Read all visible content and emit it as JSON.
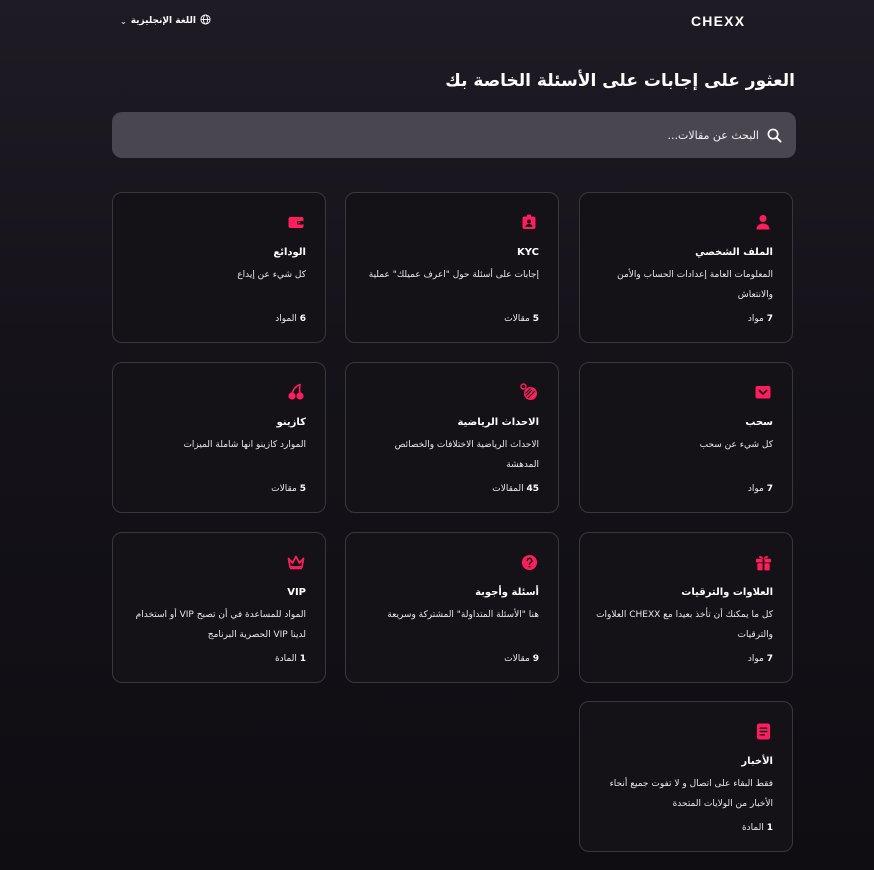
{
  "brand": {
    "logo_text": "CHEXX",
    "accent": "#ff1d5e"
  },
  "header": {
    "language_label": "اللغة الإنجليزية"
  },
  "hero": {
    "title": "العثور على إجابات على الأسئلة الخاصة بك"
  },
  "search": {
    "placeholder": "البحث عن مقالات..."
  },
  "cards": [
    {
      "icon": "user-icon",
      "title": "الملف الشخصي",
      "desc": "المعلومات العامة إعدادات الحساب والأمن والانتعاش",
      "count_num": "7",
      "count_unit": "مواد"
    },
    {
      "icon": "id-badge-icon",
      "title": "KYC",
      "desc": "إجابات على أسئلة حول \"اعرف عميلك\" عملية",
      "count_num": "5",
      "count_unit": "مقالات"
    },
    {
      "icon": "wallet-icon",
      "title": "الودائع",
      "desc": "كل شيء عن إيداع",
      "count_num": "6",
      "count_unit": "المواد"
    },
    {
      "icon": "withdraw-icon",
      "title": "سحب",
      "desc": "كل شيء عن سحب",
      "count_num": "7",
      "count_unit": "مواد"
    },
    {
      "icon": "sports-ball-icon",
      "title": "الاحداث الرياضية",
      "desc": "الاحداث الرياضية الاختلافات والخصائص المدهشة",
      "count_num": "45",
      "count_unit": "المقالات"
    },
    {
      "icon": "cherries-icon",
      "title": "كازينو",
      "desc": "الموارد كازينو انها شاملة الميزات",
      "count_num": "5",
      "count_unit": "مقالات"
    },
    {
      "icon": "gift-icon",
      "title": "العلاوات والترقيات",
      "desc": "كل ما يمكنك أن تأخذ بعيدا مع CHEXX العلاوات والترقيات",
      "count_num": "7",
      "count_unit": "مواد"
    },
    {
      "icon": "question-icon",
      "title": "أسئلة وأجوبة",
      "desc": "هنا \"الأسئلة المتداولة\" المشتركة وسريعة",
      "count_num": "9",
      "count_unit": "مقالات"
    },
    {
      "icon": "crown-icon",
      "title": "VIP",
      "desc": "المواد للمساعدة في أن تصبح VIP أو استخدام لدينا VIP الحصرية البرنامج",
      "count_num": "1",
      "count_unit": "المادة"
    },
    {
      "icon": "news-icon",
      "title": "الأخبار",
      "desc": "فقط البقاء على اتصال و لا تفوت جميع أنحاء الأخبار من الولايات المتحدة",
      "count_num": "1",
      "count_unit": "المادة"
    }
  ]
}
